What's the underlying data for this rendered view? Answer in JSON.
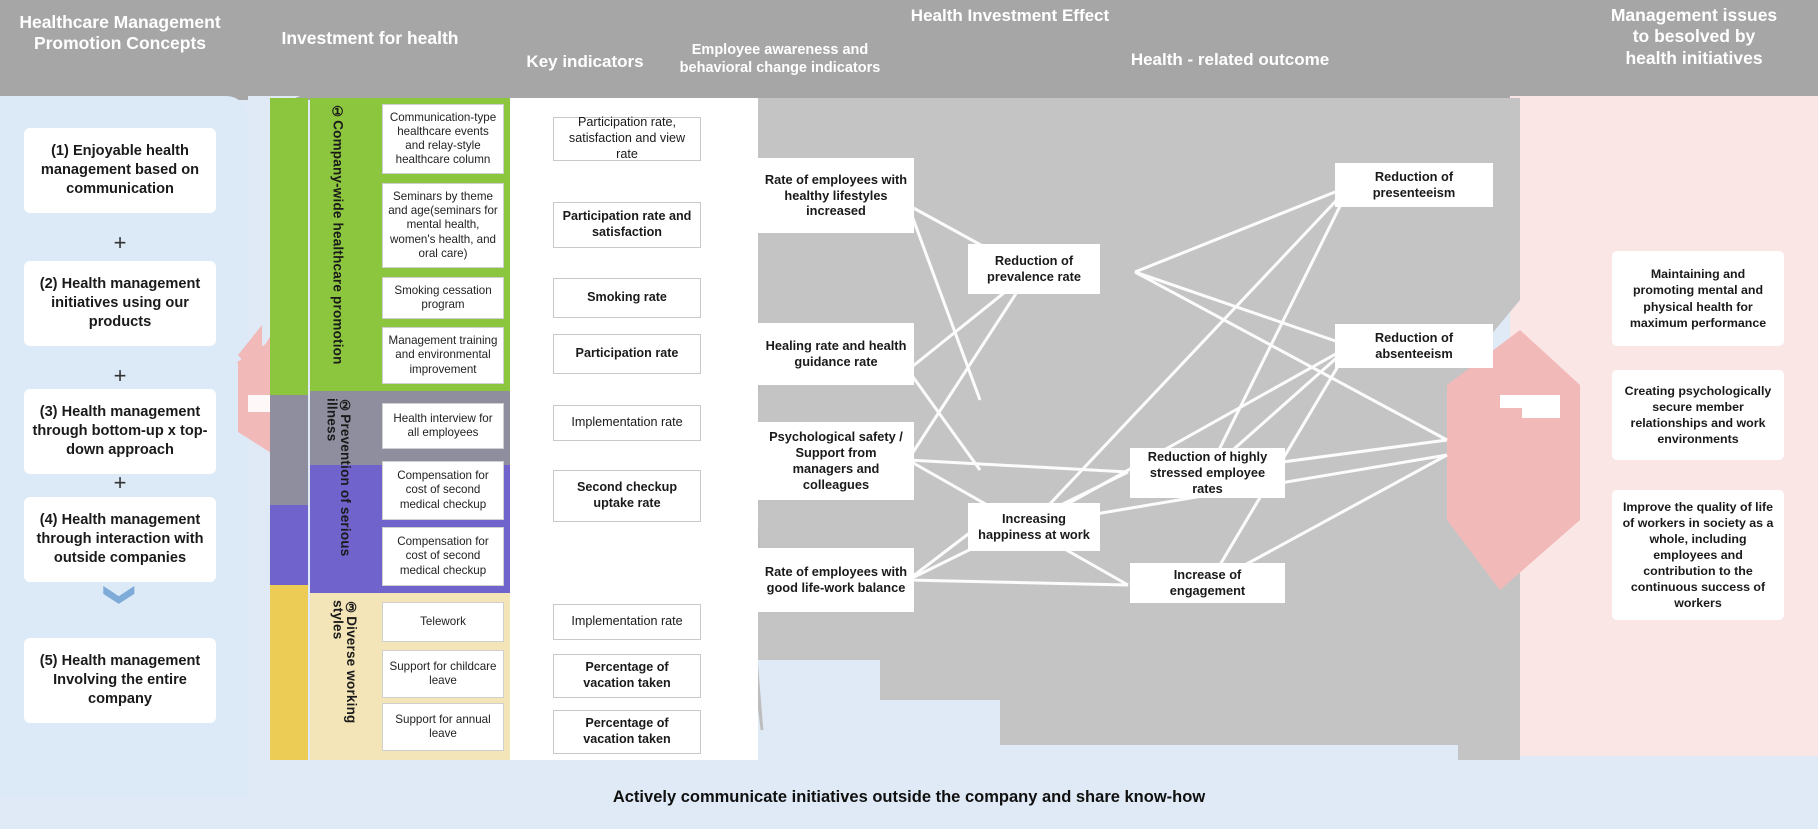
{
  "header": {
    "concepts": "Healthcare Management\nPromotion Concepts",
    "investment": "Investment for health",
    "key_indicators": "Key indicators",
    "employee_awareness": "Employee awareness and\nbehavioral change indicators",
    "health_investment_effect": "Health Investment Effect",
    "health_related_outcome": "Health - related outcome",
    "management_issues": "Management issues\nto besolved by\nhealth initiatives"
  },
  "concepts": {
    "items": [
      "(1) Enjoyable health management based on communication",
      "(2) Health management initiatives using our products",
      "(3) Health management through bottom-up x top-down approach",
      "(4) Health management through interaction with outside companies",
      "(5) Health management Involving the entire company"
    ],
    "plus": "+",
    "chevron": "❯"
  },
  "investment": {
    "groups": [
      {
        "label": "①Company-wide healthcare promotion",
        "color": "#8cc63e",
        "items": [
          "Communication-type healthcare events and relay-style healthcare column",
          "Seminars by theme and age(seminars for mental health, women's health, and oral care)",
          "Smoking cessation program",
          "Management training and environmental improvement"
        ]
      },
      {
        "label": "②Prevention of serious illness",
        "color": "#7163cc",
        "items": [
          "Health interview for all employees",
          "Compensation for cost of second medical checkup",
          "Compensation for cost of second medical checkup"
        ]
      },
      {
        "label": "③Diverse working styles",
        "color": "#eccc54",
        "items": [
          "Telework",
          "Support for childcare leave",
          "Support for annual leave"
        ]
      }
    ]
  },
  "key_indicators": {
    "items": [
      "Participation rate, satisfaction and view rate",
      "Participation rate and satisfaction",
      "Smoking rate",
      "Participation rate",
      "Implementation rate",
      "Second checkup uptake rate",
      "Implementation rate",
      "Percentage of vacation taken",
      "Percentage of vacation taken"
    ]
  },
  "employee_awareness": {
    "items": [
      "Rate of employees with healthy lifestyles increased",
      "Healing rate and health guidance rate",
      "Psychological safety / Support from managers and colleagues",
      "Rate of employees with good life-work balance"
    ]
  },
  "health_outcome": {
    "items": [
      "Reduction of prevalence rate",
      "Reduction of highly stressed employee rates",
      "Increasing happiness at work",
      "Increase of engagement",
      "Reduction of presenteeism",
      "Reduction of absenteeism"
    ]
  },
  "management_issues": {
    "items": [
      "Maintaining and promoting mental and physical health for maximum performance",
      "Creating psychologically secure member relationships and work environments",
      "Improve the quality of life of workers in society as a whole, including employees and contribution to the continuous success of workers"
    ]
  },
  "footer": {
    "text": "Actively communicate initiatives outside the company and share know-how"
  },
  "colors": {
    "header_gray": "#a6a6a6",
    "left_blue": "#dce9f7",
    "page_blue": "#dfeaf6",
    "green": "#8cc63e",
    "gray_band": "#8e8e9e",
    "purple": "#7163cc",
    "yellow": "#eccc54",
    "yellow_light": "#f3e5b8",
    "outcome_gray": "#c4c4c4",
    "pink": "#fbe6e6",
    "pink_arrow": "#f2b9b9",
    "connector": "#bdbdbd",
    "chevron_blue": "#7fabd8"
  }
}
